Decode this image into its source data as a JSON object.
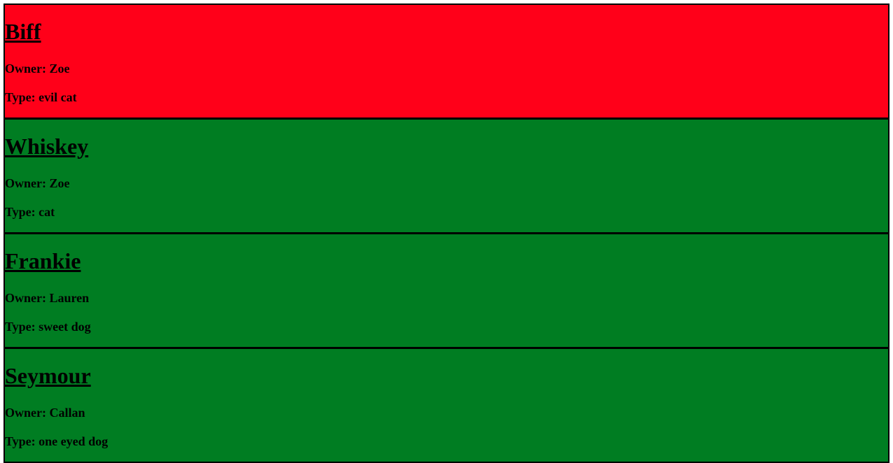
{
  "pets": [
    {
      "name": "Biff",
      "owner": "Owner: Zoe",
      "type": "Type: evil cat",
      "color": "#ff0019"
    },
    {
      "name": "Whiskey",
      "owner": "Owner: Zoe",
      "type": "Type: cat",
      "color": "#007d22"
    },
    {
      "name": "Frankie",
      "owner": "Owner: Lauren",
      "type": "Type: sweet dog",
      "color": "#007d22"
    },
    {
      "name": "Seymour",
      "owner": "Owner: Callan",
      "type": "Type: one eyed dog",
      "color": "#007d22"
    }
  ]
}
